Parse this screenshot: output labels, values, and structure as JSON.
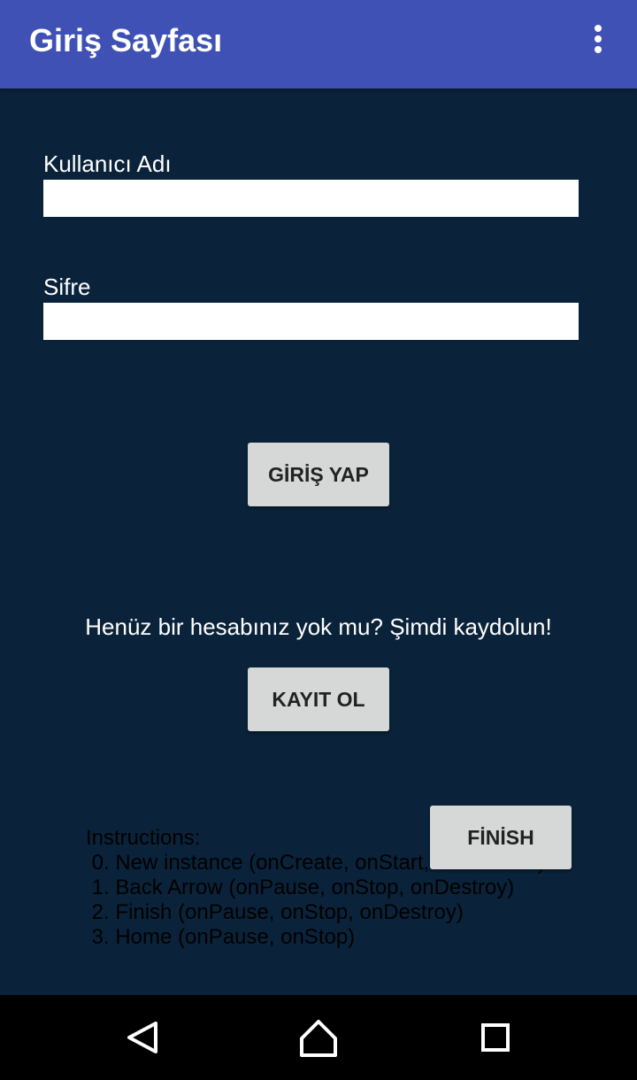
{
  "app_bar": {
    "title": "Giriş Sayfası",
    "menu_icon": "overflow-menu-icon"
  },
  "form": {
    "username_label": "Kullanıcı Adı",
    "username_value": "",
    "password_label": "Sifre",
    "password_value": ""
  },
  "login_button": "GİRİŞ YAP",
  "register_prompt": "Henüz bir hesabınız yok mu? Şimdi kaydolun!",
  "register_button": "KAYIT OL",
  "finish_button": "FİNİSH",
  "instructions": {
    "heading": "Instructions:",
    "items": [
      " 0. New instance (onCreate, onStart, onResume)",
      " 1. Back Arrow (onPause, onStop, onDestroy)",
      " 2. Finish (onPause, onStop, onDestroy)",
      " 3. Home (onPause, onStop)"
    ]
  },
  "nav_bar": {
    "back_icon": "back-triangle-icon",
    "home_icon": "home-icon",
    "recents_icon": "recents-square-icon"
  },
  "colors": {
    "app_bar": "#3f51b5",
    "background": "#0a233a",
    "button": "#d6d7d7",
    "nav_bar": "#000000"
  }
}
